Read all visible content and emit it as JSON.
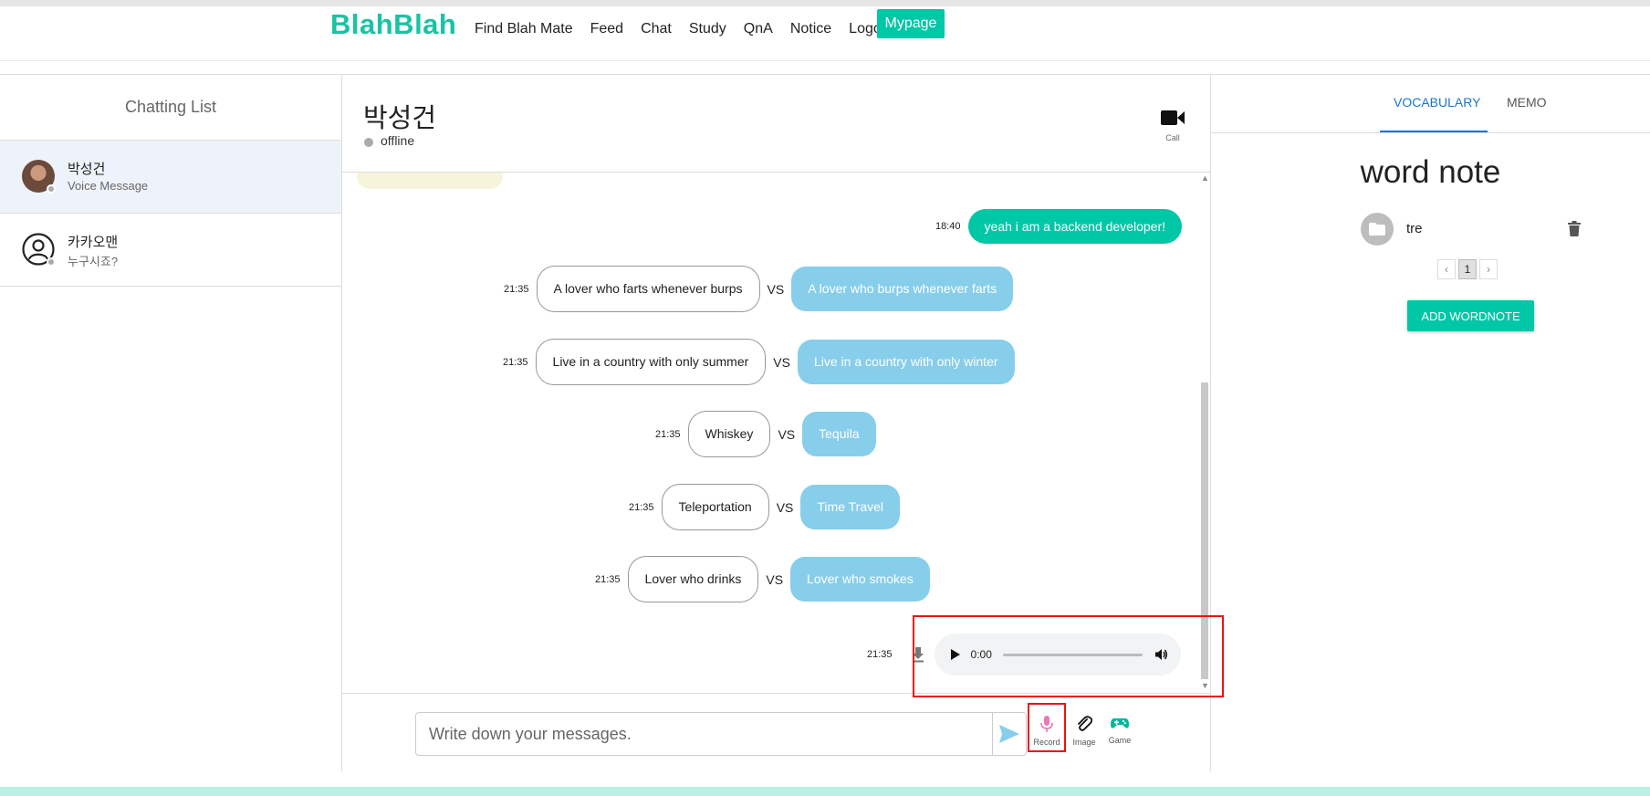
{
  "nav": {
    "logo": "BlahBlah",
    "links": [
      "Find Blah Mate",
      "Feed",
      "Chat",
      "Study",
      "QnA",
      "Notice",
      "Logout"
    ],
    "mypage": "Mypage"
  },
  "chat_list": {
    "title": "Chatting List",
    "items": [
      {
        "name": "박성건",
        "sub": "Voice Message",
        "active": true
      },
      {
        "name": "카카오맨",
        "sub": "누구시죠?",
        "active": false
      }
    ]
  },
  "chat": {
    "partner": "박성건",
    "status": "offline",
    "call_label": "Call",
    "messages": {
      "mine": {
        "time": "18:40",
        "text": "yeah i am a backend developer!"
      },
      "vs": [
        {
          "time": "21:35",
          "left": "A lover who farts whenever burps",
          "vs": "VS",
          "right": "A lover who burps whenever farts"
        },
        {
          "time": "21:35",
          "left": "Live in a country with only summer",
          "vs": "VS",
          "right": "Live in a country with only winter"
        },
        {
          "time": "21:35",
          "left": "Whiskey",
          "vs": "VS",
          "right": "Tequila"
        },
        {
          "time": "21:35",
          "left": "Teleportation",
          "vs": "VS",
          "right": "Time Travel"
        },
        {
          "time": "21:35",
          "left": "Lover who drinks",
          "vs": "VS",
          "right": "Lover who smokes"
        }
      ],
      "audio": {
        "time": "21:35",
        "current": "0:00"
      }
    },
    "composer": {
      "placeholder": "Write down your messages.",
      "record": "Record",
      "image": "Image",
      "game": "Game"
    }
  },
  "sidebar_right": {
    "tabs": [
      "VOCABULARY",
      "MEMO"
    ],
    "title": "word note",
    "words": [
      {
        "name": "tre"
      }
    ],
    "page": "1",
    "prev": "‹",
    "next": "›",
    "add_button": "ADD WORDNOTE"
  },
  "colors": {
    "brand": "#00c7a6",
    "option_right": "#87ceeb",
    "highlight": "#ee1111"
  }
}
